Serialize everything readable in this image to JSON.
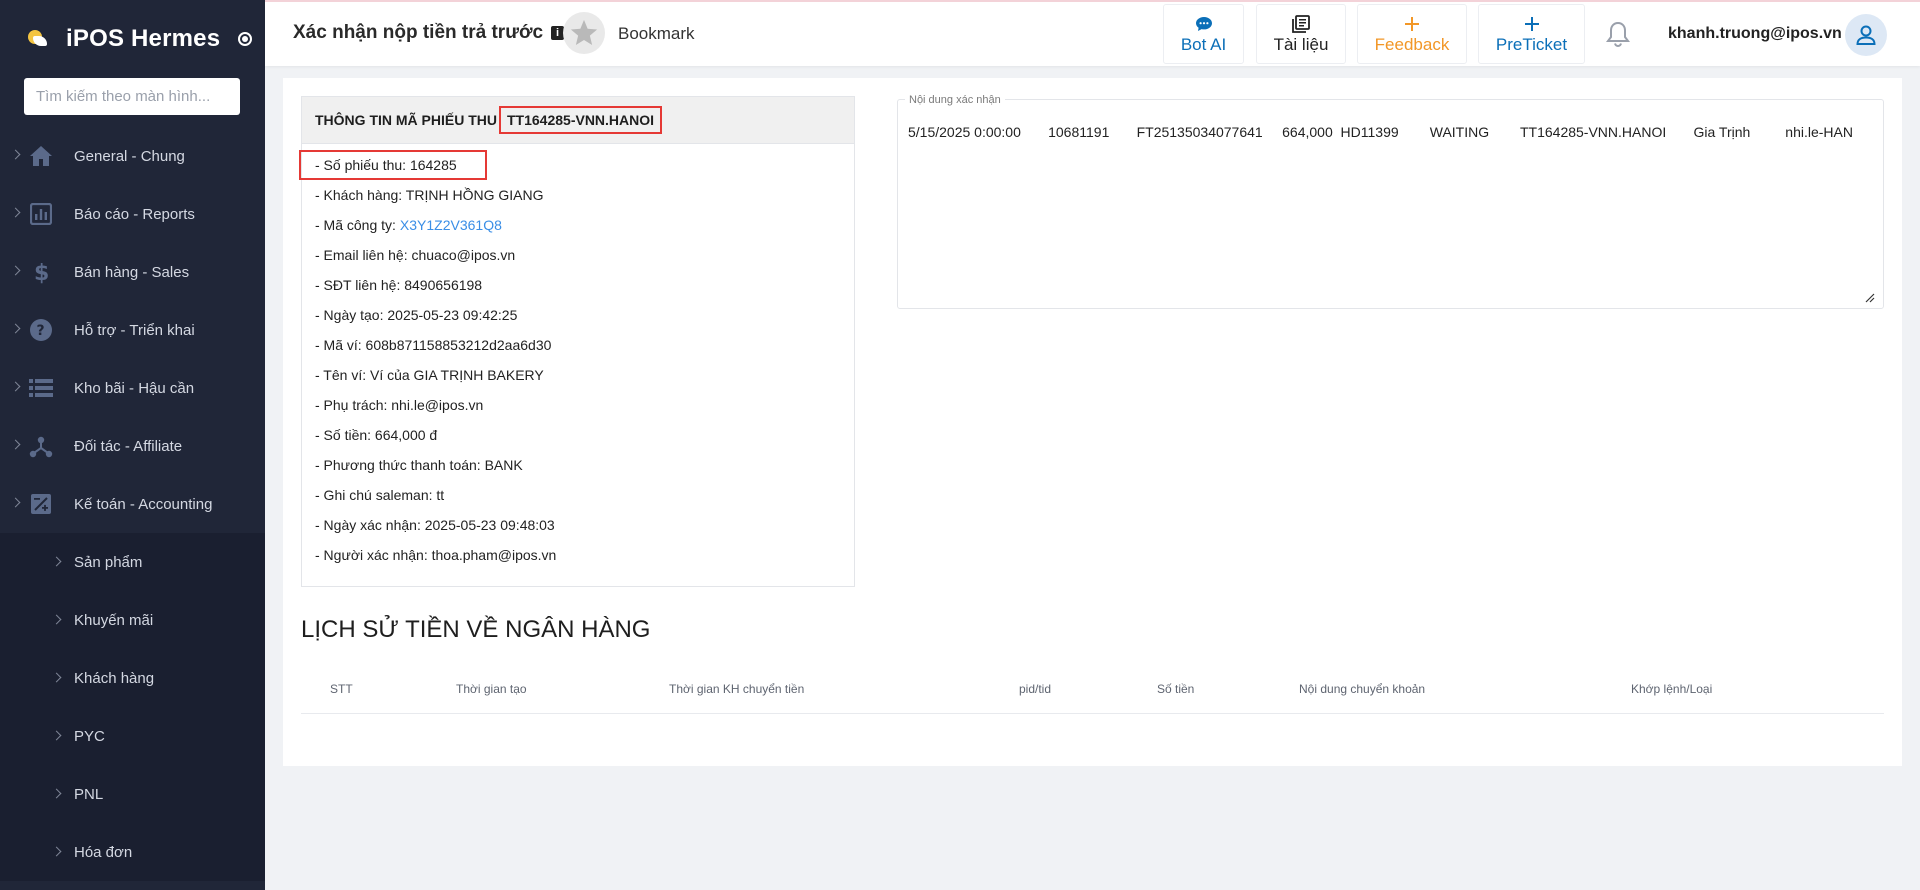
{
  "sidebar": {
    "brand": "iPOS Hermes",
    "search_placeholder": "Tìm kiếm theo màn hình...",
    "items": [
      {
        "label": "General - Chung",
        "icon": "home-icon"
      },
      {
        "label": "Báo cáo - Reports",
        "icon": "report-icon"
      },
      {
        "label": "Bán hàng - Sales",
        "icon": "dollar-icon"
      },
      {
        "label": "Hỗ trợ - Triển khai",
        "icon": "help-icon"
      },
      {
        "label": "Kho bãi - Hậu cần",
        "icon": "list-icon"
      },
      {
        "label": "Đối tác - Affiliate",
        "icon": "network-icon"
      },
      {
        "label": "Kế toán - Accounting",
        "icon": "accounting-icon"
      }
    ],
    "subitems": [
      "Sản phẩm",
      "Khuyến mãi",
      "Khách hàng",
      "PYC",
      "PNL",
      "Hóa đơn"
    ]
  },
  "header": {
    "title": "Xác nhận nộp tiền trả trước",
    "info_glyph": "i",
    "bookmark_label": "Bookmark",
    "buttons": [
      {
        "label": "Bot AI",
        "icon": "chat-icon",
        "color": "#0b6fb8"
      },
      {
        "label": "Tài liệu",
        "icon": "docs-icon",
        "color": "#222222"
      },
      {
        "label": "Feedback",
        "icon": "plus-icon",
        "color": "#f29727"
      },
      {
        "label": "PreTicket",
        "icon": "plus-icon",
        "color": "#0b6fb8"
      }
    ],
    "user_email": "khanh.truong@ipos.vn"
  },
  "receipt": {
    "heading": "THÔNG TIN MÃ PHIẾU THU",
    "code": "TT164285-VNN.HANOI",
    "receipt_no": "- Số phiếu thu: 164285",
    "customer": "- Khách hàng: TRỊNH HỒNG GIANG",
    "company_label": "- Mã công ty:",
    "company_code": "X3Y1Z2V361Q8",
    "email": "- Email liên hệ: chuaco@ipos.vn",
    "phone": "- SĐT liên hệ: 8490656198",
    "created": "- Ngày tạo: 2025-05-23 09:42:25",
    "wallet_id": "- Mã ví: 608b871158853212d2aa6d30",
    "wallet_name": "- Tên ví: Ví của GIA TRỊNH BAKERY",
    "owner": "- Phụ trách: nhi.le@ipos.vn",
    "amount": "- Số tiền: 664,000 đ",
    "payment_method": "- Phương thức thanh toán: BANK",
    "sales_note": "- Ghi chú saleman: tt",
    "confirmed_at": "- Ngày xác nhận: 2025-05-23 09:48:03",
    "confirmed_by": "- Người xác nhận: thoa.pham@ipos.vn"
  },
  "confirm": {
    "label": "Nội dung xác nhận",
    "text": "5/15/2025 0:00:00       10681191       FT25135034077641     664,000  HD11399        WAITING        TT164285-VNN.HANOI       Gia Trịnh         nhi.le-HAN"
  },
  "bank_history": {
    "title": "LỊCH SỬ TIỀN VỀ NGÂN HÀNG",
    "columns": [
      "STT",
      "Thời gian tạo",
      "Thời gian KH chuyển tiền",
      "pid/tid",
      "Số tiền",
      "Nội dung chuyển khoản",
      "Khớp lệnh/Loại"
    ]
  }
}
